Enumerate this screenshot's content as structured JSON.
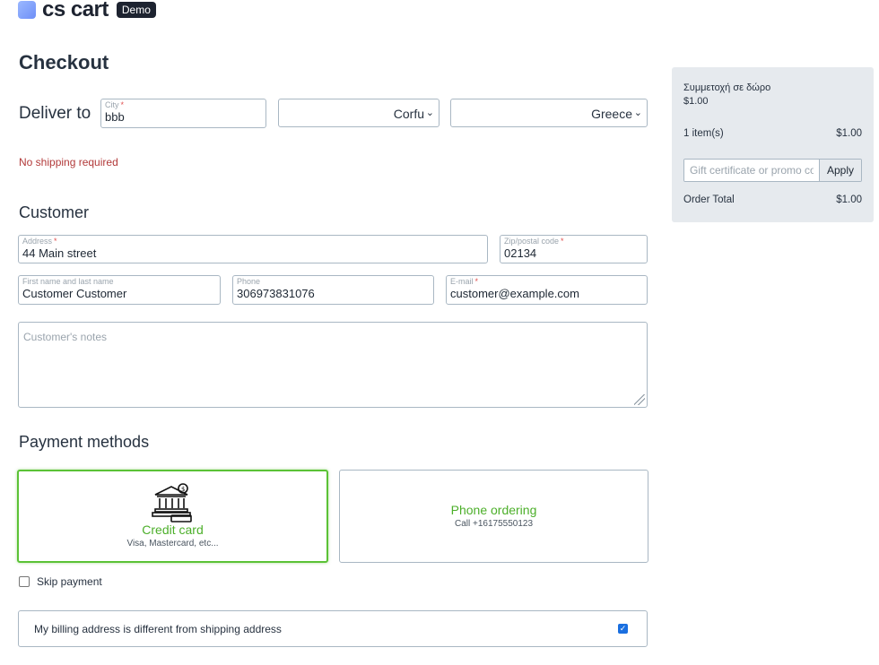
{
  "brand": {
    "logo_text": "cs cart",
    "badge": "Demo"
  },
  "page": {
    "title": "Checkout"
  },
  "deliver": {
    "label": "Deliver to",
    "city": {
      "label": "City",
      "value": "bbb"
    },
    "state_value": "Corfu",
    "country_value": "Greece",
    "no_shipping": "No shipping required"
  },
  "customer": {
    "title": "Customer",
    "address": {
      "label": "Address",
      "value": "44 Main street"
    },
    "zip": {
      "label": "Zip/postal code",
      "value": "02134"
    },
    "name": {
      "label": "First name and last name",
      "value": "Customer Customer"
    },
    "phone": {
      "label": "Phone",
      "value": "306973831076"
    },
    "email": {
      "label": "E-mail",
      "value": "customer@example.com"
    },
    "notes_placeholder": "Customer's notes"
  },
  "payment": {
    "title": "Payment methods",
    "methods": [
      {
        "title": "Credit card",
        "subtitle": "Visa, Mastercard, etc...",
        "selected": true,
        "icon": "bank-icon"
      },
      {
        "title": "Phone ordering",
        "subtitle": "Call +16175550123",
        "selected": false
      }
    ],
    "skip_label": "Skip payment",
    "billing_label": "My billing address is different from shipping address",
    "billing_checked": true
  },
  "summary": {
    "gift_name": "Συμμετοχή σε δώρο",
    "gift_price": "$1.00",
    "items_label": "1 item(s)",
    "items_total": "$1.00",
    "promo_placeholder": "Gift certificate or promo code",
    "apply_label": "Apply",
    "order_total_label": "Order Total",
    "order_total": "$1.00"
  },
  "colors": {
    "accent_green": "#5bc236",
    "error_red": "#b23a3a",
    "checkbox_blue": "#1a6fe0"
  }
}
